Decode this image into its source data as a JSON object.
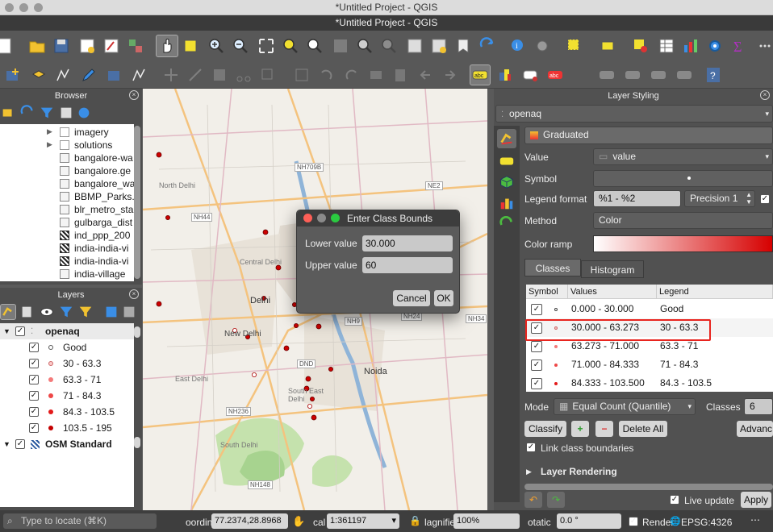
{
  "window": {
    "title_top": "*Untitled Project - QGIS",
    "title_main": "*Untitled Project - QGIS"
  },
  "browser": {
    "title": "Browser",
    "items": [
      {
        "label": "imagery",
        "icon": "folder-icon"
      },
      {
        "label": "solutions",
        "icon": "folder-icon"
      },
      {
        "label": "bangalore-wa",
        "icon": "file-icon"
      },
      {
        "label": "bangalore.ge",
        "icon": "file-icon"
      },
      {
        "label": "bangalore_wa",
        "icon": "file-icon"
      },
      {
        "label": "BBMP_Parks.",
        "icon": "file-icon"
      },
      {
        "label": "blr_metro_sta",
        "icon": "file-icon"
      },
      {
        "label": "gulbarga_dist",
        "icon": "file-icon"
      },
      {
        "label": "ind_ppp_200",
        "icon": "raster-icon"
      },
      {
        "label": "india-india-vi",
        "icon": "raster-icon"
      },
      {
        "label": "india-india-vi",
        "icon": "raster-icon"
      },
      {
        "label": "india-village",
        "icon": "file-icon"
      }
    ]
  },
  "layers": {
    "title": "Layers",
    "root_layer": "openaq",
    "classes": [
      {
        "label": "Good",
        "color": "#ffffff"
      },
      {
        "label": "30 - 63.3",
        "color": "#fbcaca"
      },
      {
        "label": "63.3 - 71",
        "color": "#f47a7a"
      },
      {
        "label": "71 - 84.3",
        "color": "#ee4747"
      },
      {
        "label": "84.3 - 103.5",
        "color": "#e31a1a"
      },
      {
        "label": "103.5 - 195",
        "color": "#c40000"
      }
    ],
    "base_layer": "OSM Standard"
  },
  "map": {
    "labels": [
      "Delhi",
      "New Delhi",
      "Central Delhi",
      "Noida",
      "South Delhi",
      "South East Delhi",
      "North Delhi",
      "East Delhi",
      "NH709B",
      "NE2",
      "NH44",
      "NH9",
      "NH24",
      "NH34",
      "DND",
      "NH236",
      "NH148"
    ],
    "range_colors": {
      "low": "#ffffff",
      "high": "#d60000"
    }
  },
  "dialog": {
    "title": "Enter Class Bounds",
    "lower_label": "Lower value",
    "lower_value": "30.000",
    "upper_label": "Upper value",
    "upper_value": "60",
    "cancel": "Cancel",
    "ok": "OK"
  },
  "styling": {
    "title": "Layer Styling",
    "layer": "openaq",
    "renderer": "Graduated",
    "value_label": "Value",
    "value": "value",
    "symbol_label": "Symbol",
    "legend_format_label": "Legend format",
    "legend_format": "%1 - %2",
    "precision": "Precision 1",
    "method_label": "Method",
    "method": "Color",
    "color_ramp_label": "Color ramp",
    "tab_classes": "Classes",
    "tab_histogram": "Histogram",
    "col_symbol": "Symbol",
    "col_values": "Values",
    "col_legend": "Legend",
    "rows": [
      {
        "values": "0.000 - 30.000",
        "legend": "Good",
        "color": "#ffffff"
      },
      {
        "values": "30.000 - 63.273",
        "legend": "30 - 63.3",
        "color": "#fbcaca"
      },
      {
        "values": "63.273 - 71.000",
        "legend": "63.3 - 71",
        "color": "#f47a7a"
      },
      {
        "values": "71.000 - 84.333",
        "legend": "71 - 84.3",
        "color": "#ee4747"
      },
      {
        "values": "84.333 - 103.500",
        "legend": "84.3 - 103.5",
        "color": "#e31a1a"
      }
    ],
    "mode_label": "Mode",
    "mode": "Equal Count (Quantile)",
    "classes_label": "Classes",
    "classes_count": "6",
    "classify": "Classify",
    "delete_all": "Delete All",
    "advanced": "Advanc",
    "link_boundaries": "Link class boundaries",
    "layer_rendering": "Layer Rendering",
    "live_update": "Live update",
    "apply": "Apply"
  },
  "statusbar": {
    "locate_placeholder": "Type to locate (⌘K)",
    "coord_label": "oordinat",
    "coord_value": "77.2374,28.8968",
    "scale_label": "cal",
    "scale_value": "1:361197",
    "magnifier_label": "lagnifie",
    "magnifier_value": "100%",
    "rotation_label": "otatic",
    "rotation_value": "0.0 °",
    "render_label": "Render",
    "crs": "EPSG:4326"
  }
}
